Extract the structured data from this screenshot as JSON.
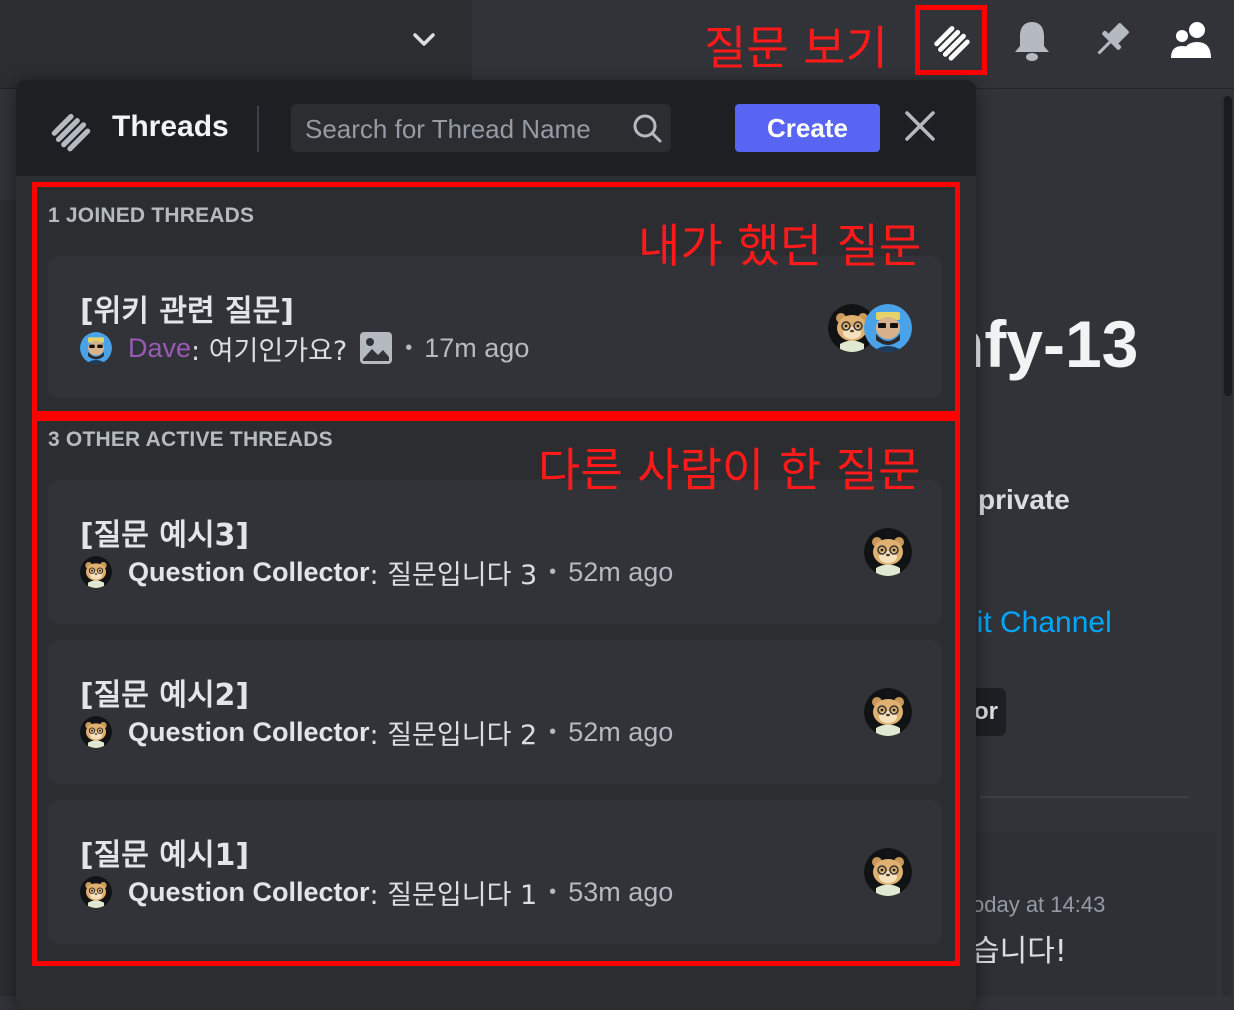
{
  "annotations": {
    "view_questions": "질문 보기",
    "my_questions": "내가 했던 질문",
    "others_questions": "다른 사람이 한 질문"
  },
  "topbar": {
    "icons": [
      "threads-icon",
      "bell-icon",
      "pin-icon",
      "members-icon"
    ]
  },
  "background": {
    "channel_title_partial": "nfy-13",
    "private_text": "private",
    "edit_channel_link": "lit Channel",
    "tag_button_partial": "or",
    "timestamp_partial": "oday at 14:43",
    "message_partial": "습니다!"
  },
  "threads_popup": {
    "title": "Threads",
    "search_placeholder": "Search for Thread Name",
    "create_label": "Create",
    "joined_header": "1 JOINED THREADS",
    "other_header": "3 OTHER ACTIVE THREADS",
    "joined": [
      {
        "title": "[위키 관련 질문]",
        "author": "Dave",
        "author_color": "#9b59b6",
        "message": ": 여기인가요?",
        "has_image": true,
        "time_ago": "17m ago"
      }
    ],
    "others": [
      {
        "title": "[질문 예시3]",
        "author": "Question Collector",
        "message": ": 질문입니다 3",
        "time_ago": "52m ago"
      },
      {
        "title": "[질문 예시2]",
        "author": "Question Collector",
        "message": ": 질문입니다 2",
        "time_ago": "52m ago"
      },
      {
        "title": "[질문 예시1]",
        "author": "Question Collector",
        "message": ": 질문입니다 1",
        "time_ago": "53m ago"
      }
    ]
  },
  "colors": {
    "accent": "#5865f2",
    "annotation_red": "#ff0000",
    "link_blue": "#00a8fc"
  }
}
